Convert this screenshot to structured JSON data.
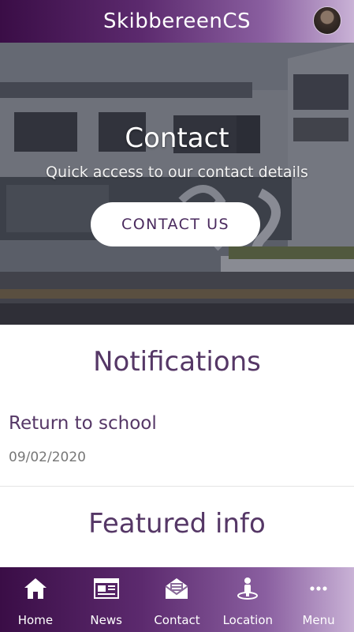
{
  "header": {
    "title": "SkibbereenCS"
  },
  "hero": {
    "title": "Contact",
    "subtitle": "Quick access to our contact details",
    "button_label": "CONTACT US"
  },
  "notifications": {
    "heading": "Notifications",
    "items": [
      {
        "title": "Return to school",
        "date": "09/02/2020"
      }
    ]
  },
  "featured": {
    "heading": "Featured info"
  },
  "tabbar": {
    "tabs": [
      {
        "label": "Home",
        "icon": "home-icon"
      },
      {
        "label": "News",
        "icon": "news-icon"
      },
      {
        "label": "Contact",
        "icon": "envelope-icon"
      },
      {
        "label": "Location",
        "icon": "location-icon"
      },
      {
        "label": "Menu",
        "icon": "more-icon"
      }
    ]
  },
  "colors": {
    "brand_dark": "#3a0d46",
    "brand_light": "#c9b2d6",
    "heading_text": "#553766"
  }
}
